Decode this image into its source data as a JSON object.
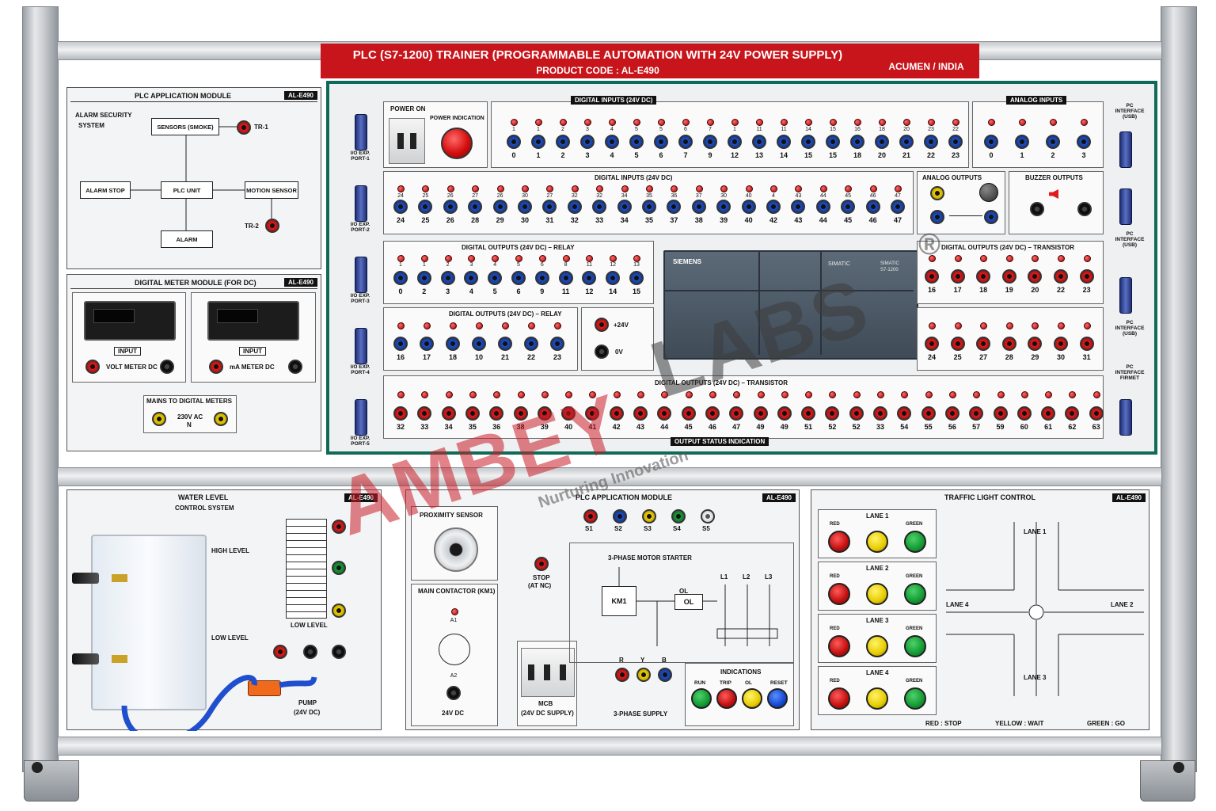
{
  "header": {
    "title": "PLC (S7-1200) TRAINER (PROGRAMMABLE AUTOMATION WITH 24V POWER SUPPLY)",
    "product_code": "PRODUCT CODE : AL-E490",
    "maker": "ACUMEN / INDIA"
  },
  "code_tag": "AL-E490",
  "plc_app_module": {
    "title": "PLC APPLICATION MODULE",
    "alarm_security": "ALARM SECURITY",
    "system": "SYSTEM",
    "sensors": "SENSORS (SMOKE)",
    "tr1": "TR-1",
    "alarm_stop": "ALARM STOP",
    "plc_unit": "PLC UNIT",
    "motion_sensor": "MOTION SENSOR",
    "tr2": "TR-2",
    "alarm": "ALARM"
  },
  "digital_meter": {
    "title": "DIGITAL METER MODULE (FOR DC)",
    "input1": "INPUT",
    "input2": "INPUT",
    "volt": "VOLT METER DC",
    "ma": "mA METER DC",
    "mains_title": "MAINS TO DIGITAL METERS",
    "mains_label": "230V AC",
    "mains_n": "N"
  },
  "ports": [
    "I/O EXP. PORT-1",
    "I/O EXP. PORT-2",
    "I/O EXP. PORT-3",
    "I/O EXP. PORT-4",
    "I/O EXP. PORT-5"
  ],
  "pc_interface": [
    "PC INTERFACE (USB)",
    "PC INTERFACE (USB)",
    "PC INTERFACE (USB)",
    "PC INTERFACE FIRMET"
  ],
  "power": {
    "on": "POWER ON",
    "indication": "POWER INDICATION"
  },
  "di1": {
    "title": "DIGITAL INPUTS (24V DC)",
    "top": [
      "1",
      "1",
      "2",
      "3",
      "4",
      "5",
      "5",
      "6",
      "7",
      "1",
      "11",
      "11",
      "14",
      "15",
      "16",
      "18",
      "20",
      "23",
      "22",
      "23"
    ],
    "bottom": [
      "0",
      "1",
      "2",
      "3",
      "4",
      "5",
      "6",
      "7",
      "9",
      "12",
      "13",
      "14",
      "15",
      "15",
      "18",
      "20",
      "21",
      "22",
      "23"
    ]
  },
  "ai": {
    "title": "ANALOG INPUTS",
    "labels": [
      "0",
      "1",
      "2",
      "3"
    ]
  },
  "di2": {
    "title": "DIGITAL INPUTS (24V DC)",
    "top": [
      "24",
      "25",
      "26",
      "27",
      "26",
      "30",
      "27",
      "32",
      "32",
      "34",
      "35",
      "36",
      "37",
      "30",
      "40",
      "4",
      "43",
      "44",
      "45",
      "46",
      "47"
    ],
    "bottom": [
      "24",
      "25",
      "26",
      "28",
      "29",
      "30",
      "31",
      "32",
      "33",
      "34",
      "35",
      "37",
      "38",
      "39",
      "40",
      "42",
      "43",
      "44",
      "45",
      "46",
      "47"
    ]
  },
  "ao": {
    "title": "ANALOG OUTPUTS"
  },
  "buzzer": {
    "title": "BUZZER OUTPUTS"
  },
  "dor1": {
    "title": "DIGITAL OUTPUTS (24V DC) – RELAY",
    "top": [
      "1",
      "1",
      "2",
      "3",
      "4",
      "5",
      "6",
      "8",
      "11",
      "12",
      "13",
      "14",
      "15"
    ],
    "bottom": [
      "0",
      "2",
      "3",
      "4",
      "5",
      "6",
      "9",
      "11",
      "12",
      "14",
      "15"
    ]
  },
  "dor2": {
    "title": "DIGITAL OUTPUTS (24V DC) – RELAY",
    "labels": [
      "16",
      "17",
      "18",
      "10",
      "21",
      "22",
      "23"
    ],
    "plus24": "+24V",
    "zero": "0V"
  },
  "plc": {
    "brand": "SIEMENS",
    "simatic": "SIMATIC",
    "model_a": "SIMATIC",
    "model_b": "S7-1200"
  },
  "dot1": {
    "title": "DIGITAL OUTPUTS (24V DC) – TRANSISTOR",
    "labels": [
      "16",
      "17",
      "18",
      "19",
      "20",
      "22",
      "23"
    ]
  },
  "dot2": {
    "labels": [
      "24",
      "25",
      "27",
      "28",
      "29",
      "30",
      "31"
    ]
  },
  "dot3": {
    "title": "DIGITAL OUTPUTS (24V DC) – TRANSISTOR",
    "labels": [
      "32",
      "33",
      "34",
      "35",
      "36",
      "38",
      "39",
      "40",
      "41",
      "42",
      "43",
      "44",
      "45",
      "46",
      "47",
      "49",
      "49",
      "51",
      "52",
      "52",
      "33",
      "54",
      "55",
      "56",
      "57",
      "59",
      "60",
      "61",
      "62",
      "63"
    ]
  },
  "output_status": "OUTPUT STATUS INDICATION",
  "water": {
    "title": "WATER LEVEL",
    "subtitle": "CONTROL SYSTEM",
    "high": "HIGH LEVEL",
    "low": "LOW LEVEL",
    "low_level": "LOW LEVEL",
    "pump": "PUMP",
    "pump_v": "(24V DC)"
  },
  "plc_app2": {
    "title": "PLC APPLICATION MODULE",
    "proximity": "PROXIMITY SENSOR",
    "s_labels": [
      "S1",
      "S2",
      "S3",
      "S4",
      "S5"
    ],
    "stop": "STOP",
    "stop_nc": "(AT NC)",
    "starter": "3-PHASE MOTOR STARTER",
    "km1": "KM1",
    "ol": "OL",
    "ol2": "OL",
    "l_labels": [
      "L1",
      "L2",
      "L3"
    ],
    "main_contactor": "MAIN CONTACTOR (KM1)",
    "a1": "A1",
    "a2": "A2",
    "dc24": "24V DC",
    "mcb": "MCB",
    "mcb_sub": "(24V DC SUPPLY)",
    "ryb": [
      "R",
      "Y",
      "B"
    ],
    "supply": "3-PHASE SUPPLY",
    "indications": "INDICATIONS",
    "ind_labels": [
      "RUN",
      "TRIP",
      "OL",
      "RESET"
    ]
  },
  "traffic": {
    "title": "TRAFFIC LIGHT CONTROL",
    "lanes": [
      "LANE 1",
      "LANE 2",
      "LANE 3",
      "LANE 4"
    ],
    "red": "RED",
    "green": "GREEN",
    "junction": [
      "LANE 1",
      "LANE 2",
      "LANE 3",
      "LANE 4"
    ],
    "legend_red": "RED : STOP",
    "legend_yellow": "YELLOW : WAIT",
    "legend_green": "GREEN : GO"
  },
  "watermark": {
    "brand": "AMBEY",
    "labs": "LABS",
    "reg": "®",
    "tagline": "Nurturing Innovation"
  }
}
